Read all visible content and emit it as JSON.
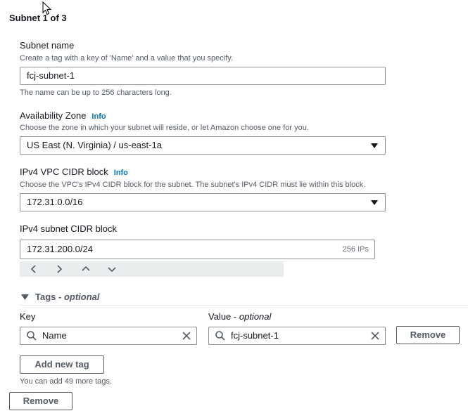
{
  "subnet_header": "Subnet 1 of 3",
  "subnet_name": {
    "label": "Subnet name",
    "description": "Create a tag with a key of 'Name' and a value that you specify.",
    "value": "fcj-subnet-1",
    "hint": "The name can be up to 256 characters long."
  },
  "availability_zone": {
    "label": "Availability Zone",
    "info": "Info",
    "description": "Choose the zone in which your subnet will reside, or let Amazon choose one for you.",
    "selected": "US East (N. Virginia) / us-east-1a"
  },
  "vpc_cidr": {
    "label": "IPv4 VPC CIDR block",
    "info": "Info",
    "description": "Choose the VPC's IPv4 CIDR block for the subnet. The subnet's IPv4 CIDR must lie within this block.",
    "selected": "172.31.0.0/16"
  },
  "subnet_cidr": {
    "label": "IPv4 subnet CIDR block",
    "value": "172.31.200.0/24",
    "ip_count": "256 IPs"
  },
  "tags": {
    "title": "Tags",
    "title_suffix": "optional",
    "key_label": "Key",
    "value_label": "Value",
    "value_label_suffix": "optional",
    "rows": [
      {
        "key": "Name",
        "value": "fcj-subnet-1",
        "remove_label": "Remove"
      }
    ],
    "add_label": "Add new tag",
    "limit_text": "You can add 49 more tags."
  },
  "remove_subnet_label": "Remove",
  "icons": {
    "cursor": "mouse-pointer-icon",
    "dropdown": "caret-down-icon",
    "search": "search-icon",
    "clear": "close-icon",
    "stepper": [
      "chevron-left-icon",
      "chevron-right-icon",
      "chevron-up-icon",
      "chevron-down-icon"
    ]
  },
  "colors": {
    "link": "#0073bb",
    "text": "#16191f",
    "muted": "#545b64",
    "border": "#879196"
  }
}
